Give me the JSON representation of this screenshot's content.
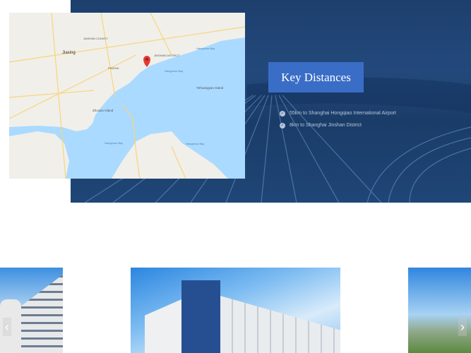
{
  "key_distances": {
    "title": "Key Distances",
    "items": [
      "55km to Shanghai Hongqiao International Airport",
      "8km to Shanghai Jinshan District"
    ]
  },
  "map": {
    "labels": {
      "jiaxing": "Jiaxing",
      "jiashan": "JIASHAN COUNTY",
      "pinghu": "PINGHU",
      "jinshan": "JINSHAN DISTRICT",
      "bay1": "Hangzhou Bay",
      "bay2": "Hangzhou Bay",
      "bay3": "Hangzhou Bay",
      "bay4": "Hangzhou Bay",
      "island": "Yehuangyan Island",
      "zhapu": "Zhuxiao Island"
    }
  },
  "carousel": {
    "prev": "‹",
    "next": "›"
  },
  "colors": {
    "accent": "#3a6dc6",
    "hero": "#23497c",
    "water": "#aadaff"
  }
}
